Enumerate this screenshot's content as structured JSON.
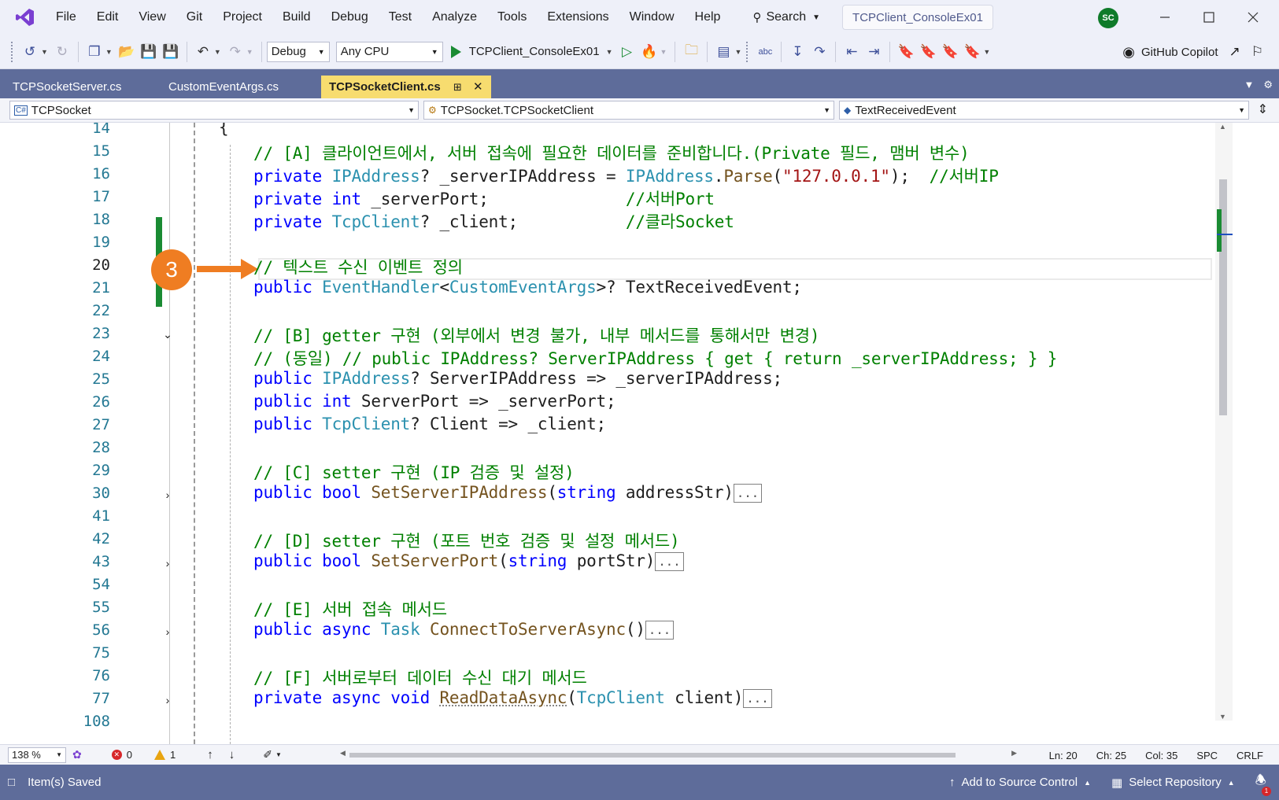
{
  "menu": {
    "items": [
      "File",
      "Edit",
      "View",
      "Git",
      "Project",
      "Build",
      "Debug",
      "Test",
      "Analyze",
      "Tools",
      "Extensions",
      "Window",
      "Help"
    ],
    "search_label": "Search",
    "solution_title": "TCPClient_ConsoleEx01",
    "avatar_initials": "SC"
  },
  "toolbar": {
    "configuration": "Debug",
    "platform": "Any CPU",
    "startup_project": "TCPClient_ConsoleEx01",
    "copilot_label": "GitHub Copilot"
  },
  "tabs": [
    {
      "label": "TCPSocketServer.cs",
      "active": false
    },
    {
      "label": "CustomEventArgs.cs",
      "active": false
    },
    {
      "label": "TCPSocketClient.cs",
      "active": true
    }
  ],
  "navbar": {
    "project": "TCPSocket",
    "type": "TCPSocket.TCPSocketClient",
    "member": "TextReceivedEvent"
  },
  "editor": {
    "current_line": "20",
    "callout_number": "3",
    "lines": [
      {
        "num": "14",
        "text": "{"
      },
      {
        "num": "15",
        "text": "// [A] 클라이언트에서, 서버 접속에 필요한 데이터를 준비합니다.(Private 필드, 맴버 변수)"
      },
      {
        "num": "16",
        "text": "private IPAddress? _serverIPAddress = IPAddress.Parse(\"127.0.0.1\");  //서버IP"
      },
      {
        "num": "17",
        "text": "private int _serverPort;              //서버Port"
      },
      {
        "num": "18",
        "text": "private TcpClient? _client;           //클라Socket"
      },
      {
        "num": "19",
        "text": ""
      },
      {
        "num": "20",
        "text": "// 텍스트 수신 이벤트 정의"
      },
      {
        "num": "21",
        "text": "public EventHandler<CustomEventArgs>? TextReceivedEvent;"
      },
      {
        "num": "22",
        "text": ""
      },
      {
        "num": "23",
        "text": "// [B] getter 구현 (외부에서 변경 불가, 내부 메서드를 통해서만 변경)"
      },
      {
        "num": "24",
        "text": "// (동일) // public IPAddress? ServerIPAddress { get { return _serverIPAddress; } }"
      },
      {
        "num": "25",
        "text": "public IPAddress? ServerIPAddress => _serverIPAddress;"
      },
      {
        "num": "26",
        "text": "public int ServerPort => _serverPort;"
      },
      {
        "num": "27",
        "text": "public TcpClient? Client => _client;"
      },
      {
        "num": "28",
        "text": ""
      },
      {
        "num": "29",
        "text": "// [C] setter 구현 (IP 검증 및 설정)"
      },
      {
        "num": "30",
        "text": "public bool SetServerIPAddress(string addressStr)..."
      },
      {
        "num": "41",
        "text": ""
      },
      {
        "num": "42",
        "text": "// [D] setter 구현 (포트 번호 검증 및 설정 메서드)"
      },
      {
        "num": "43",
        "text": "public bool SetServerPort(string portStr)..."
      },
      {
        "num": "54",
        "text": ""
      },
      {
        "num": "55",
        "text": "// [E] 서버 접속 메서드"
      },
      {
        "num": "56",
        "text": "public async Task ConnectToServerAsync()..."
      },
      {
        "num": "75",
        "text": ""
      },
      {
        "num": "76",
        "text": "// [F] 서버로부터 데이터 수신 대기 메서드"
      },
      {
        "num": "77",
        "text": "private async void ReadDataAsync(TcpClient client)..."
      },
      {
        "num": "108",
        "text": ""
      }
    ]
  },
  "editor_status": {
    "zoom": "138 %",
    "errors": "0",
    "warnings": "1",
    "line": "Ln: 20",
    "char": "Ch: 25",
    "col": "Col: 35",
    "whitespace": "SPC",
    "line_ending": "CRLF"
  },
  "statusbar": {
    "message": "Item(s) Saved",
    "source_control": "Add to Source Control",
    "repository": "Select Repository",
    "notifications": "1"
  },
  "colors": {
    "accent": "#5e6c9a",
    "active_tab": "#f7dc6f",
    "callout": "#ef7d22",
    "change_marker": "#1a8b33"
  }
}
